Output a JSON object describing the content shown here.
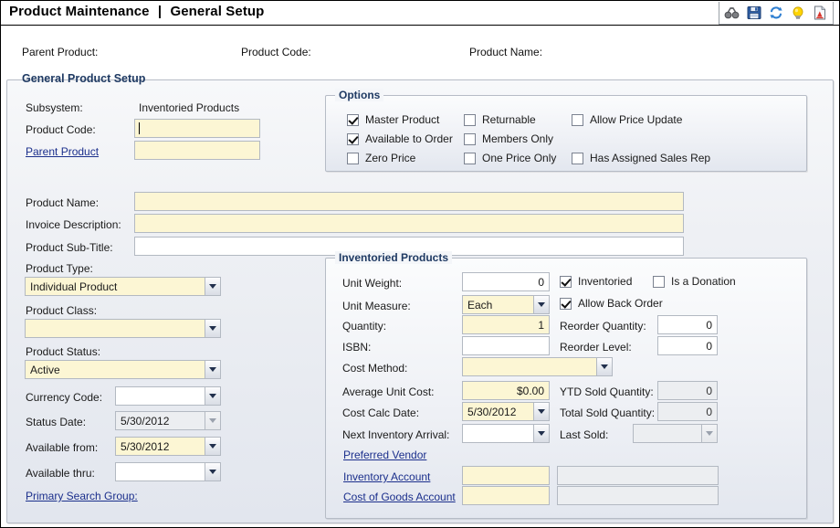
{
  "window": {
    "title_main": "Product Maintenance",
    "title_sep": "|",
    "title_sub": "General Setup"
  },
  "toolbar": {
    "items": [
      {
        "name": "binoculars-icon",
        "label": "Find"
      },
      {
        "name": "save-icon",
        "label": "Save"
      },
      {
        "name": "refresh-icon",
        "label": "Refresh"
      },
      {
        "name": "lightbulb-icon",
        "label": "Hints"
      },
      {
        "name": "report-icon",
        "label": "Report"
      }
    ]
  },
  "header": {
    "parent_product_label": "Parent Product:",
    "parent_product_value": "",
    "product_code_label": "Product Code:",
    "product_code_value": "",
    "product_name_label": "Product Name:",
    "product_name_value": ""
  },
  "general_group": {
    "legend": "General Product Setup",
    "subsystem_label": "Subsystem:",
    "subsystem_value": "Inventoried Products",
    "product_code_label": "Product Code:",
    "product_code_value": "",
    "parent_product_link": "Parent Product",
    "parent_product_value": "",
    "product_name_label": "Product Name:",
    "product_name_value": "",
    "invoice_description_label": "Invoice Description:",
    "invoice_description_value": "",
    "product_subtitle_label": "Product Sub-Title:",
    "product_subtitle_value": "",
    "product_type_label": "Product Type:",
    "product_type_value": "Individual Product",
    "product_class_label": "Product Class:",
    "product_class_value": "",
    "product_status_label": "Product Status:",
    "product_status_value": "Active",
    "currency_code_label": "Currency Code:",
    "currency_code_value": "",
    "status_date_label": "Status Date:",
    "status_date_value": "5/30/2012",
    "available_from_label": "Available from:",
    "available_from_value": "5/30/2012",
    "available_thru_label": "Available thru:",
    "available_thru_value": "",
    "primary_search_group_link": "Primary Search Group:"
  },
  "options_group": {
    "legend": "Options",
    "checkboxes": [
      {
        "label": "Master Product",
        "checked": true,
        "col": 0,
        "row": 0
      },
      {
        "label": "Available to Order",
        "checked": true,
        "col": 0,
        "row": 1
      },
      {
        "label": "Zero Price",
        "checked": false,
        "col": 0,
        "row": 2
      },
      {
        "label": "Returnable",
        "checked": false,
        "col": 1,
        "row": 0
      },
      {
        "label": "Members Only",
        "checked": false,
        "col": 1,
        "row": 1
      },
      {
        "label": "One Price Only",
        "checked": false,
        "col": 1,
        "row": 2
      },
      {
        "label": "Allow Price Update",
        "checked": false,
        "col": 2,
        "row": 0
      },
      {
        "label": "Has Assigned Sales Rep",
        "checked": false,
        "col": 2,
        "row": 2
      }
    ]
  },
  "inventoried_group": {
    "legend": "Inventoried Products",
    "unit_weight_label": "Unit Weight:",
    "unit_weight_value": "0",
    "unit_measure_label": "Unit Measure:",
    "unit_measure_value": "Each",
    "quantity_label": "Quantity:",
    "quantity_value": "1",
    "isbn_label": "ISBN:",
    "isbn_value": "",
    "cost_method_label": "Cost Method:",
    "cost_method_value": "",
    "average_unit_cost_label": "Average Unit Cost:",
    "average_unit_cost_value": "$0.00",
    "cost_calc_date_label": "Cost Calc Date:",
    "cost_calc_date_value": "5/30/2012",
    "next_inventory_arrival_label": "Next Inventory Arrival:",
    "next_inventory_arrival_value": "",
    "inventoried_cb_label": "Inventoried",
    "inventoried_cb_checked": true,
    "is_a_donation_cb_label": "Is a Donation",
    "is_a_donation_cb_checked": false,
    "allow_back_order_cb_label": "Allow Back Order",
    "allow_back_order_cb_checked": true,
    "reorder_quantity_label": "Reorder Quantity:",
    "reorder_quantity_value": "0",
    "reorder_level_label": "Reorder Level:",
    "reorder_level_value": "0",
    "ytd_sold_quantity_label": "YTD Sold Quantity:",
    "ytd_sold_quantity_value": "0",
    "total_sold_quantity_label": "Total Sold Quantity:",
    "total_sold_quantity_value": "0",
    "last_sold_label": "Last Sold:",
    "last_sold_value": "",
    "preferred_vendor_link": "Preferred Vendor",
    "preferred_vendor_value": "",
    "inventory_account_link": "Inventory Account",
    "inventory_account_value": "",
    "inventory_account_desc": "",
    "cost_of_goods_account_link": "Cost of Goods Account",
    "cost_of_goods_account_value": "",
    "cost_of_goods_account_desc": ""
  },
  "colors": {
    "required_field": "#fcf6d4",
    "readonly_field": "#eceef1",
    "link": "#1b2f8c",
    "legend": "#1f3a63",
    "panel_border": "#b6bcc6"
  }
}
